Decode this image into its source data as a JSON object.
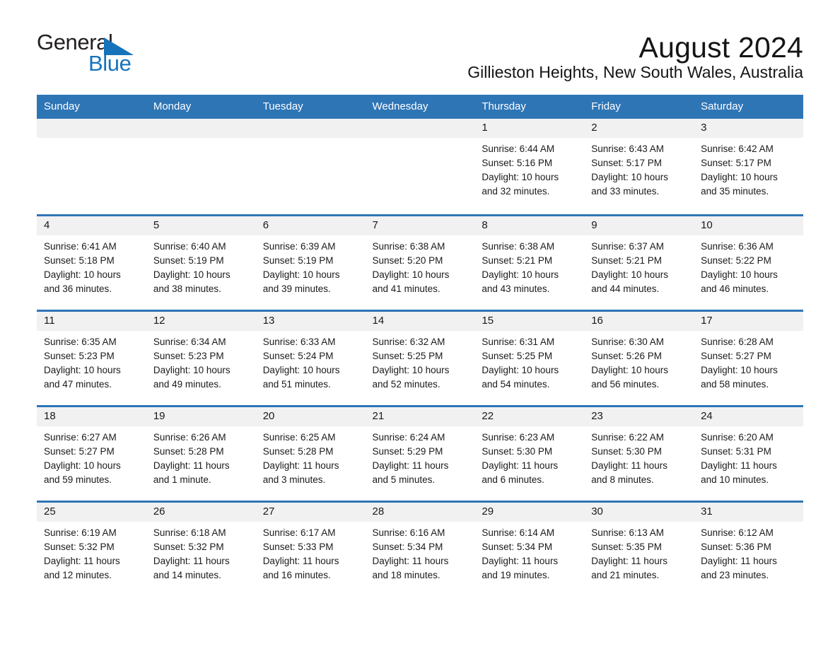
{
  "brand": {
    "name_part1": "General",
    "name_part2": "Blue",
    "accent_color": "#1573bb"
  },
  "header": {
    "title": "August 2024",
    "location": "Gillieston Heights, New South Wales, Australia",
    "header_bg": "#2e75b6",
    "daynum_bg": "#f1f1f1"
  },
  "weekday_headers": [
    "Sunday",
    "Monday",
    "Tuesday",
    "Wednesday",
    "Thursday",
    "Friday",
    "Saturday"
  ],
  "labels": {
    "sunrise": "Sunrise:",
    "sunset": "Sunset:",
    "daylight": "Daylight:"
  },
  "weeks": [
    [
      {
        "day": ""
      },
      {
        "day": ""
      },
      {
        "day": ""
      },
      {
        "day": ""
      },
      {
        "day": "1",
        "sunrise": "Sunrise: 6:44 AM",
        "sunset": "Sunset: 5:16 PM",
        "daylight_line1": "Daylight: 10 hours",
        "daylight_line2": "and 32 minutes."
      },
      {
        "day": "2",
        "sunrise": "Sunrise: 6:43 AM",
        "sunset": "Sunset: 5:17 PM",
        "daylight_line1": "Daylight: 10 hours",
        "daylight_line2": "and 33 minutes."
      },
      {
        "day": "3",
        "sunrise": "Sunrise: 6:42 AM",
        "sunset": "Sunset: 5:17 PM",
        "daylight_line1": "Daylight: 10 hours",
        "daylight_line2": "and 35 minutes."
      }
    ],
    [
      {
        "day": "4",
        "sunrise": "Sunrise: 6:41 AM",
        "sunset": "Sunset: 5:18 PM",
        "daylight_line1": "Daylight: 10 hours",
        "daylight_line2": "and 36 minutes."
      },
      {
        "day": "5",
        "sunrise": "Sunrise: 6:40 AM",
        "sunset": "Sunset: 5:19 PM",
        "daylight_line1": "Daylight: 10 hours",
        "daylight_line2": "and 38 minutes."
      },
      {
        "day": "6",
        "sunrise": "Sunrise: 6:39 AM",
        "sunset": "Sunset: 5:19 PM",
        "daylight_line1": "Daylight: 10 hours",
        "daylight_line2": "and 39 minutes."
      },
      {
        "day": "7",
        "sunrise": "Sunrise: 6:38 AM",
        "sunset": "Sunset: 5:20 PM",
        "daylight_line1": "Daylight: 10 hours",
        "daylight_line2": "and 41 minutes."
      },
      {
        "day": "8",
        "sunrise": "Sunrise: 6:38 AM",
        "sunset": "Sunset: 5:21 PM",
        "daylight_line1": "Daylight: 10 hours",
        "daylight_line2": "and 43 minutes."
      },
      {
        "day": "9",
        "sunrise": "Sunrise: 6:37 AM",
        "sunset": "Sunset: 5:21 PM",
        "daylight_line1": "Daylight: 10 hours",
        "daylight_line2": "and 44 minutes."
      },
      {
        "day": "10",
        "sunrise": "Sunrise: 6:36 AM",
        "sunset": "Sunset: 5:22 PM",
        "daylight_line1": "Daylight: 10 hours",
        "daylight_line2": "and 46 minutes."
      }
    ],
    [
      {
        "day": "11",
        "sunrise": "Sunrise: 6:35 AM",
        "sunset": "Sunset: 5:23 PM",
        "daylight_line1": "Daylight: 10 hours",
        "daylight_line2": "and 47 minutes."
      },
      {
        "day": "12",
        "sunrise": "Sunrise: 6:34 AM",
        "sunset": "Sunset: 5:23 PM",
        "daylight_line1": "Daylight: 10 hours",
        "daylight_line2": "and 49 minutes."
      },
      {
        "day": "13",
        "sunrise": "Sunrise: 6:33 AM",
        "sunset": "Sunset: 5:24 PM",
        "daylight_line1": "Daylight: 10 hours",
        "daylight_line2": "and 51 minutes."
      },
      {
        "day": "14",
        "sunrise": "Sunrise: 6:32 AM",
        "sunset": "Sunset: 5:25 PM",
        "daylight_line1": "Daylight: 10 hours",
        "daylight_line2": "and 52 minutes."
      },
      {
        "day": "15",
        "sunrise": "Sunrise: 6:31 AM",
        "sunset": "Sunset: 5:25 PM",
        "daylight_line1": "Daylight: 10 hours",
        "daylight_line2": "and 54 minutes."
      },
      {
        "day": "16",
        "sunrise": "Sunrise: 6:30 AM",
        "sunset": "Sunset: 5:26 PM",
        "daylight_line1": "Daylight: 10 hours",
        "daylight_line2": "and 56 minutes."
      },
      {
        "day": "17",
        "sunrise": "Sunrise: 6:28 AM",
        "sunset": "Sunset: 5:27 PM",
        "daylight_line1": "Daylight: 10 hours",
        "daylight_line2": "and 58 minutes."
      }
    ],
    [
      {
        "day": "18",
        "sunrise": "Sunrise: 6:27 AM",
        "sunset": "Sunset: 5:27 PM",
        "daylight_line1": "Daylight: 10 hours",
        "daylight_line2": "and 59 minutes."
      },
      {
        "day": "19",
        "sunrise": "Sunrise: 6:26 AM",
        "sunset": "Sunset: 5:28 PM",
        "daylight_line1": "Daylight: 11 hours",
        "daylight_line2": "and 1 minute."
      },
      {
        "day": "20",
        "sunrise": "Sunrise: 6:25 AM",
        "sunset": "Sunset: 5:28 PM",
        "daylight_line1": "Daylight: 11 hours",
        "daylight_line2": "and 3 minutes."
      },
      {
        "day": "21",
        "sunrise": "Sunrise: 6:24 AM",
        "sunset": "Sunset: 5:29 PM",
        "daylight_line1": "Daylight: 11 hours",
        "daylight_line2": "and 5 minutes."
      },
      {
        "day": "22",
        "sunrise": "Sunrise: 6:23 AM",
        "sunset": "Sunset: 5:30 PM",
        "daylight_line1": "Daylight: 11 hours",
        "daylight_line2": "and 6 minutes."
      },
      {
        "day": "23",
        "sunrise": "Sunrise: 6:22 AM",
        "sunset": "Sunset: 5:30 PM",
        "daylight_line1": "Daylight: 11 hours",
        "daylight_line2": "and 8 minutes."
      },
      {
        "day": "24",
        "sunrise": "Sunrise: 6:20 AM",
        "sunset": "Sunset: 5:31 PM",
        "daylight_line1": "Daylight: 11 hours",
        "daylight_line2": "and 10 minutes."
      }
    ],
    [
      {
        "day": "25",
        "sunrise": "Sunrise: 6:19 AM",
        "sunset": "Sunset: 5:32 PM",
        "daylight_line1": "Daylight: 11 hours",
        "daylight_line2": "and 12 minutes."
      },
      {
        "day": "26",
        "sunrise": "Sunrise: 6:18 AM",
        "sunset": "Sunset: 5:32 PM",
        "daylight_line1": "Daylight: 11 hours",
        "daylight_line2": "and 14 minutes."
      },
      {
        "day": "27",
        "sunrise": "Sunrise: 6:17 AM",
        "sunset": "Sunset: 5:33 PM",
        "daylight_line1": "Daylight: 11 hours",
        "daylight_line2": "and 16 minutes."
      },
      {
        "day": "28",
        "sunrise": "Sunrise: 6:16 AM",
        "sunset": "Sunset: 5:34 PM",
        "daylight_line1": "Daylight: 11 hours",
        "daylight_line2": "and 18 minutes."
      },
      {
        "day": "29",
        "sunrise": "Sunrise: 6:14 AM",
        "sunset": "Sunset: 5:34 PM",
        "daylight_line1": "Daylight: 11 hours",
        "daylight_line2": "and 19 minutes."
      },
      {
        "day": "30",
        "sunrise": "Sunrise: 6:13 AM",
        "sunset": "Sunset: 5:35 PM",
        "daylight_line1": "Daylight: 11 hours",
        "daylight_line2": "and 21 minutes."
      },
      {
        "day": "31",
        "sunrise": "Sunrise: 6:12 AM",
        "sunset": "Sunset: 5:36 PM",
        "daylight_line1": "Daylight: 11 hours",
        "daylight_line2": "and 23 minutes."
      }
    ]
  ]
}
